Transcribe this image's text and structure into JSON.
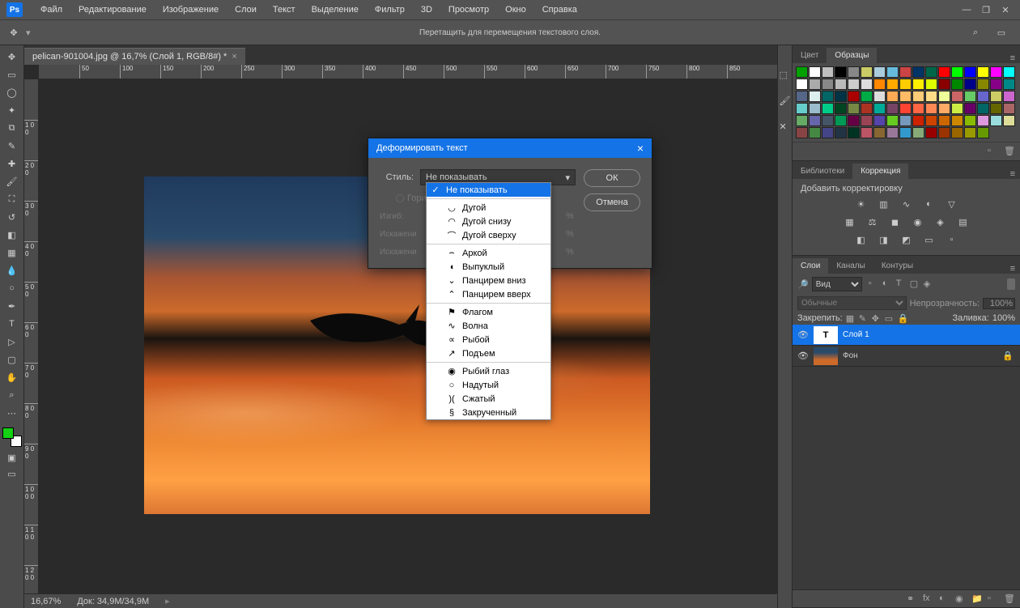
{
  "menubar": {
    "logo": "Ps",
    "items": [
      "Файл",
      "Редактирование",
      "Изображение",
      "Слои",
      "Текст",
      "Выделение",
      "Фильтр",
      "3D",
      "Просмотр",
      "Окно",
      "Справка"
    ]
  },
  "optionsbar": {
    "message": "Перетащить для перемещения текстового слоя."
  },
  "document": {
    "tab_title": "pelican-901004.jpg @ 16,7% (Слой 1, RGB/8#) *"
  },
  "statusbar": {
    "zoom": "16,67%",
    "doc_info": "Док: 34,9M/34,9M"
  },
  "ruler_h": [
    "50",
    "100",
    "150",
    "200",
    "250",
    "300",
    "350",
    "400",
    "450",
    "500",
    "550",
    "600",
    "650",
    "700",
    "750",
    "800",
    "850"
  ],
  "ruler_v": [
    "1 0 0",
    "2 0 0",
    "3 0 0",
    "4 0 0",
    "5 0 0",
    "6 0 0",
    "7 0 0",
    "8 0 0",
    "9 0 0",
    "1 0 0 0",
    "1 1 0 0",
    "1 2 0 0"
  ],
  "panels": {
    "color": {
      "tabs": [
        "Цвет",
        "Образцы"
      ],
      "active": 1
    },
    "corrections": {
      "tabs": [
        "Библиотеки",
        "Коррекция"
      ],
      "active": 1,
      "label": "Добавить корректировку"
    },
    "layers": {
      "tabs": [
        "Слои",
        "Каналы",
        "Контуры"
      ],
      "active": 0,
      "filter_kind": "Вид",
      "blend_mode": "Обычные",
      "opacity_label": "Непрозрачность:",
      "opacity_value": "100%",
      "lock_label": "Закрепить:",
      "fill_label": "Заливка:",
      "fill_value": "100%",
      "items": [
        {
          "name": "Слой 1",
          "type": "text",
          "visible": true,
          "selected": true,
          "locked": false
        },
        {
          "name": "Фон",
          "type": "image",
          "visible": true,
          "selected": false,
          "locked": true
        }
      ]
    }
  },
  "swatch_colors": [
    "#00a000",
    "#ffffff",
    "#c0c0c0",
    "#000000",
    "#888888",
    "#cccc66",
    "#aaccdd",
    "#66bbdd",
    "#cc4444",
    "#003366",
    "#006648",
    "#ff0000",
    "#00ff00",
    "#0000ff",
    "#ffff00",
    "#ff00ff",
    "#00ffff",
    "#ffffff",
    "#aaaaaa",
    "#888888",
    "#bbbbbb",
    "#cccccc",
    "#dddddd",
    "#ff8800",
    "#ffaa00",
    "#ffcc00",
    "#ffee00",
    "#ddff00",
    "#880000",
    "#008800",
    "#000088",
    "#888800",
    "#880088",
    "#008888",
    "#556688",
    "#ddeeee",
    "#006666",
    "#003344",
    "#aa0000",
    "#00aa44",
    "#dddddd",
    "#ffaa55",
    "#ffbb66",
    "#ffcc77",
    "#ffdd88",
    "#eeff99",
    "#cc6666",
    "#66cc66",
    "#6666cc",
    "#cccc66",
    "#cc66cc",
    "#66cccc",
    "#99bbcc",
    "#00cc88",
    "#004422",
    "#778844",
    "#aa3322",
    "#00aa99",
    "#774466",
    "#ff4433",
    "#ff6644",
    "#ff8855",
    "#ffaa66",
    "#ccee44",
    "#660066",
    "#006666",
    "#666600",
    "#aa6666",
    "#66aa66",
    "#6666aa",
    "#445566",
    "#009955",
    "#660044",
    "#994455",
    "#5544aa",
    "#66cc22",
    "#7799bb",
    "#cc2200",
    "#cc4400",
    "#cc6600",
    "#cc8800",
    "#88bb00",
    "#dd99dd",
    "#99dddd",
    "#dddd99",
    "#884444",
    "#448844",
    "#444488",
    "#223344",
    "#003322",
    "#bb5566",
    "#886633",
    "#997799",
    "#3399cc",
    "#88aa77",
    "#990000",
    "#993300",
    "#996600",
    "#999900",
    "#669900"
  ],
  "dialog": {
    "title": "Деформировать текст",
    "style_label": "Стиль:",
    "style_value": "Не показывать",
    "orientation_h": "Гориз",
    "bend_label": "Изгиб:",
    "distort_h_label": "Искажени",
    "distort_v_label": "Искажени",
    "ok": "ОК",
    "cancel": "Отмена"
  },
  "dropdown": {
    "selected": "Не показывать",
    "groups": [
      [
        "Дугой",
        "Дугой снизу",
        "Дугой сверху"
      ],
      [
        "Аркой",
        "Выпуклый",
        "Панцирем вниз",
        "Панцирем вверх"
      ],
      [
        "Флагом",
        "Волна",
        "Рыбой",
        "Подъем"
      ],
      [
        "Рыбий глаз",
        "Надутый",
        "Сжатый",
        "Закрученный"
      ]
    ]
  }
}
